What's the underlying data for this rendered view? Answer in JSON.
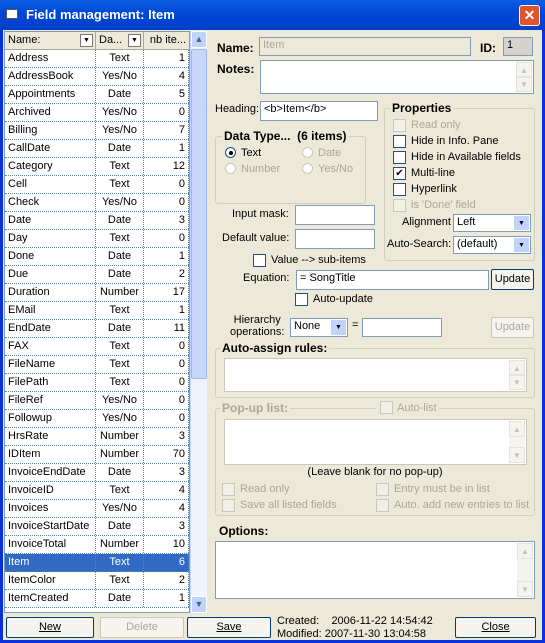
{
  "window": {
    "title": "Field management: Item",
    "close": "✕"
  },
  "list": {
    "columns": [
      "Name:",
      "Da...",
      "nb ite..."
    ],
    "rows": [
      [
        "Address",
        "Text",
        "1"
      ],
      [
        "AddressBook",
        "Yes/No",
        "4"
      ],
      [
        "Appointments",
        "Date",
        "5"
      ],
      [
        "Archived",
        "Yes/No",
        "0"
      ],
      [
        "Billing",
        "Yes/No",
        "7"
      ],
      [
        "CallDate",
        "Date",
        "1"
      ],
      [
        "Category",
        "Text",
        "12"
      ],
      [
        "Cell",
        "Text",
        "0"
      ],
      [
        "Check",
        "Yes/No",
        "0"
      ],
      [
        "Date",
        "Date",
        "3"
      ],
      [
        "Day",
        "Text",
        "0"
      ],
      [
        "Done",
        "Date",
        "1"
      ],
      [
        "Due",
        "Date",
        "2"
      ],
      [
        "Duration",
        "Number",
        "17"
      ],
      [
        "EMail",
        "Text",
        "1"
      ],
      [
        "EndDate",
        "Date",
        "11"
      ],
      [
        "FAX",
        "Text",
        "0"
      ],
      [
        "FileName",
        "Text",
        "0"
      ],
      [
        "FilePath",
        "Text",
        "0"
      ],
      [
        "FileRef",
        "Yes/No",
        "0"
      ],
      [
        "Followup",
        "Yes/No",
        "0"
      ],
      [
        "HrsRate",
        "Number",
        "3"
      ],
      [
        "IDItem",
        "Number",
        "70"
      ],
      [
        "InvoiceEndDate",
        "Date",
        "3"
      ],
      [
        "InvoiceID",
        "Text",
        "4"
      ],
      [
        "Invoices",
        "Yes/No",
        "4"
      ],
      [
        "InvoiceStartDate",
        "Date",
        "3"
      ],
      [
        "InvoiceTotal",
        "Number",
        "10"
      ],
      [
        "Item",
        "Text",
        "6"
      ],
      [
        "ItemColor",
        "Text",
        "2"
      ],
      [
        "ItemCreated",
        "Date",
        "1"
      ]
    ],
    "selected": "Item"
  },
  "form": {
    "name_label": "Name:",
    "name_value": "Item",
    "id_label": "ID:",
    "id_value": "1",
    "notes_label": "Notes:",
    "notes_value": "",
    "heading_label": "Heading:",
    "heading_value": "<b>Item</b>",
    "datatype": {
      "title": "Data Type...",
      "count": "(6 items)",
      "options": [
        "Text",
        "Date",
        "Number",
        "Yes/No"
      ],
      "selected": "Text"
    },
    "properties": {
      "title": "Properties",
      "items": [
        {
          "label": "Read only",
          "checked": false,
          "disabled": true
        },
        {
          "label": "Hide in Info. Pane",
          "checked": false,
          "disabled": false
        },
        {
          "label": "Hide in Available fields",
          "checked": false,
          "disabled": false
        },
        {
          "label": "Multi-line",
          "checked": true,
          "disabled": false
        },
        {
          "label": "Hyperlink",
          "checked": false,
          "disabled": false
        },
        {
          "label": "is 'Done' field",
          "checked": false,
          "disabled": true
        }
      ],
      "alignment_label": "Alignment",
      "alignment_value": "Left",
      "autosearch_label": "Auto-Search:",
      "autosearch_value": "(default)"
    },
    "input_mask_label": "Input mask:",
    "input_mask_value": "",
    "default_value_label": "Default value:",
    "default_value_value": "",
    "value_subitems_label": "Value --> sub-items",
    "equation_label": "Equation:",
    "equation_value": "= SongTitle",
    "update_label": "Update",
    "auto_update_label": "Auto-update",
    "hierarchy_label_1": "Hierarchy",
    "hierarchy_label_2": "operations:",
    "hierarchy_value": "None",
    "eq_sign": "=",
    "hierarchy_input": "",
    "hierarchy_update": "Update",
    "auto_assign_label": "Auto-assign rules:",
    "popup_label": "Pop-up list:",
    "autolist_label": "Auto-list",
    "popup_hint": "(Leave blank for no pop-up)",
    "popup_opts": [
      "Read only",
      "Entry must be in list",
      "Save all listed fields",
      "Auto. add new entries to list"
    ],
    "options_label": "Options:"
  },
  "footer": {
    "new": "New",
    "delete": "Delete",
    "save": "Save",
    "created_label": "Created:",
    "created": "2006-11-22 14:54:42",
    "modified_label": "Modified:",
    "modified": "2007-11-30 13:04:58",
    "close": "Close"
  }
}
